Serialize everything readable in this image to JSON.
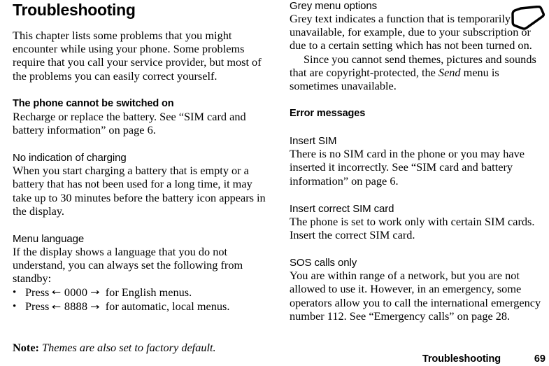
{
  "document": {
    "chapter_title": "Troubleshooting"
  },
  "left_column": {
    "intro_paragraph": "This chapter lists some problems that you might encounter while using your phone. Some problems require that you call your service provider, but most of the problems you can easily correct yourself.",
    "sections": [
      {
        "heading": "The phone cannot be switched on",
        "heading_style": "bold",
        "body": "Recharge or replace the battery. See “SIM card and battery information” on page 6."
      },
      {
        "heading": "No indication of charging",
        "heading_style": "regular",
        "body": "When you start charging a battery that is empty or a battery that has not been used for a long time, it may take up to 30 minutes before the battery icon appears in the display."
      },
      {
        "heading": "Menu language",
        "heading_style": "regular",
        "body": "If the display shows a language that you do not understand, you can always set the following from standby:"
      }
    ],
    "bullets": [
      {
        "bullet_char": "•",
        "press_label": "Press",
        "left_arrow": "←",
        "code": "0000",
        "right_arrow": "→",
        "suffix": "for English menus."
      },
      {
        "bullet_char": "•",
        "press_label": "Press",
        "left_arrow": "←",
        "code": "8888",
        "right_arrow": "→",
        "suffix": "for automatic, local menus."
      }
    ],
    "note": {
      "label": "Note:",
      "text": "Themes are also set to factory default."
    }
  },
  "right_column": {
    "grey_menu": {
      "heading": "Grey menu options",
      "heading_style": "regular",
      "paragraph_1": "Grey text indicates a function that is temporarily unavailable, for example, due to your subscription or due to a certain setting which has not been turned on.",
      "paragraph_2_part_1": "Since you cannot send themes, pictures and sounds that are copyright-protected, the ",
      "paragraph_2_italic": "Send",
      "paragraph_2_part_2": " menu is sometimes unavailable."
    },
    "error_messages": {
      "heading": "Error messages",
      "heading_style": "bold",
      "entries": [
        {
          "heading": "Insert SIM",
          "body": "There is no SIM card in the phone or you may have inserted it incorrectly. See “SIM card and battery information” on page 6."
        },
        {
          "heading": "Insert correct SIM card",
          "body": "The phone is set to work only with certain SIM cards. Insert the correct SIM card."
        },
        {
          "heading": "SOS calls only",
          "body": "You are within range of a network, but you are not allowed to use it. However, in an emergency, some operators allow you to call the international emergency number 112. See “Emergency calls” on page 28."
        }
      ]
    }
  },
  "corner_icon": {
    "name": "mobile-phone-outline-icon",
    "stroke_color": "#000000",
    "fill_color": "#ffffff"
  },
  "footer": {
    "chapter_label": "Troubleshooting",
    "page_number": "69"
  }
}
